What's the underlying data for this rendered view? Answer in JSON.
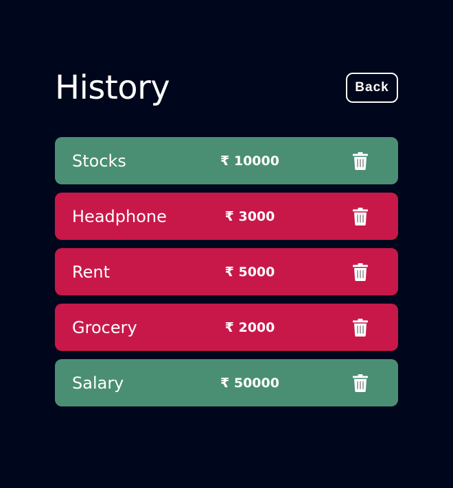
{
  "page": {
    "title": "History",
    "back_label": "Back"
  },
  "colors": {
    "background": "#00061b",
    "income": "#4a8f74",
    "expense": "#c8184a"
  },
  "transactions": [
    {
      "name": "Stocks",
      "amount": "₹ 10000",
      "type": "income",
      "icon": "trash-icon"
    },
    {
      "name": "Headphone",
      "amount": "₹ 3000",
      "type": "expense",
      "icon": "trash-icon"
    },
    {
      "name": "Rent",
      "amount": "₹ 5000",
      "type": "expense",
      "icon": "trash-icon"
    },
    {
      "name": "Grocery",
      "amount": "₹ 2000",
      "type": "expense",
      "icon": "trash-icon"
    },
    {
      "name": "Salary",
      "amount": "₹ 50000",
      "type": "income",
      "icon": "trash-icon"
    }
  ]
}
